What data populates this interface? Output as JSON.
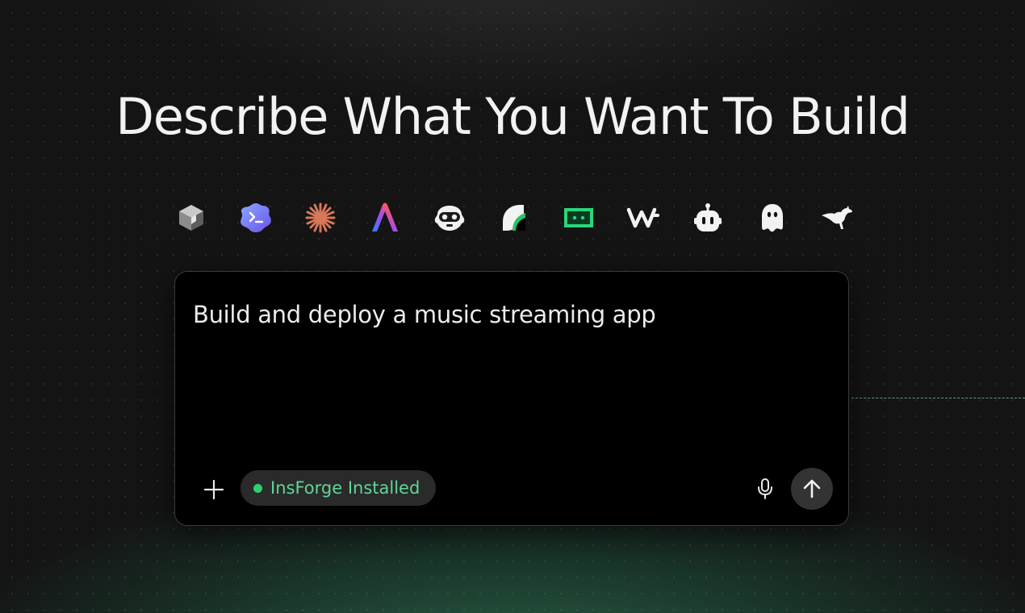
{
  "page": {
    "headline": "Describe What You Want To Build"
  },
  "tools": [
    {
      "icon": "cube-icon"
    },
    {
      "icon": "terminal-cloud-icon"
    },
    {
      "icon": "asterisk-burst-icon"
    },
    {
      "icon": "gradient-a-icon"
    },
    {
      "icon": "goggles-face-icon"
    },
    {
      "icon": "leaf-shape-icon"
    },
    {
      "icon": "green-tape-icon"
    },
    {
      "icon": "w-wave-icon"
    },
    {
      "icon": "robot-head-icon"
    },
    {
      "icon": "ghost-icon"
    },
    {
      "icon": "kangaroo-icon"
    }
  ],
  "prompt": {
    "value": "Build and deploy a music streaming app",
    "status_label": "InsForge Installed",
    "status_color": "#2fcf73"
  },
  "colors": {
    "background": "#141414",
    "card": "#000000",
    "accent_green": "#5fd69a",
    "dash_line": "#6edcb4"
  }
}
